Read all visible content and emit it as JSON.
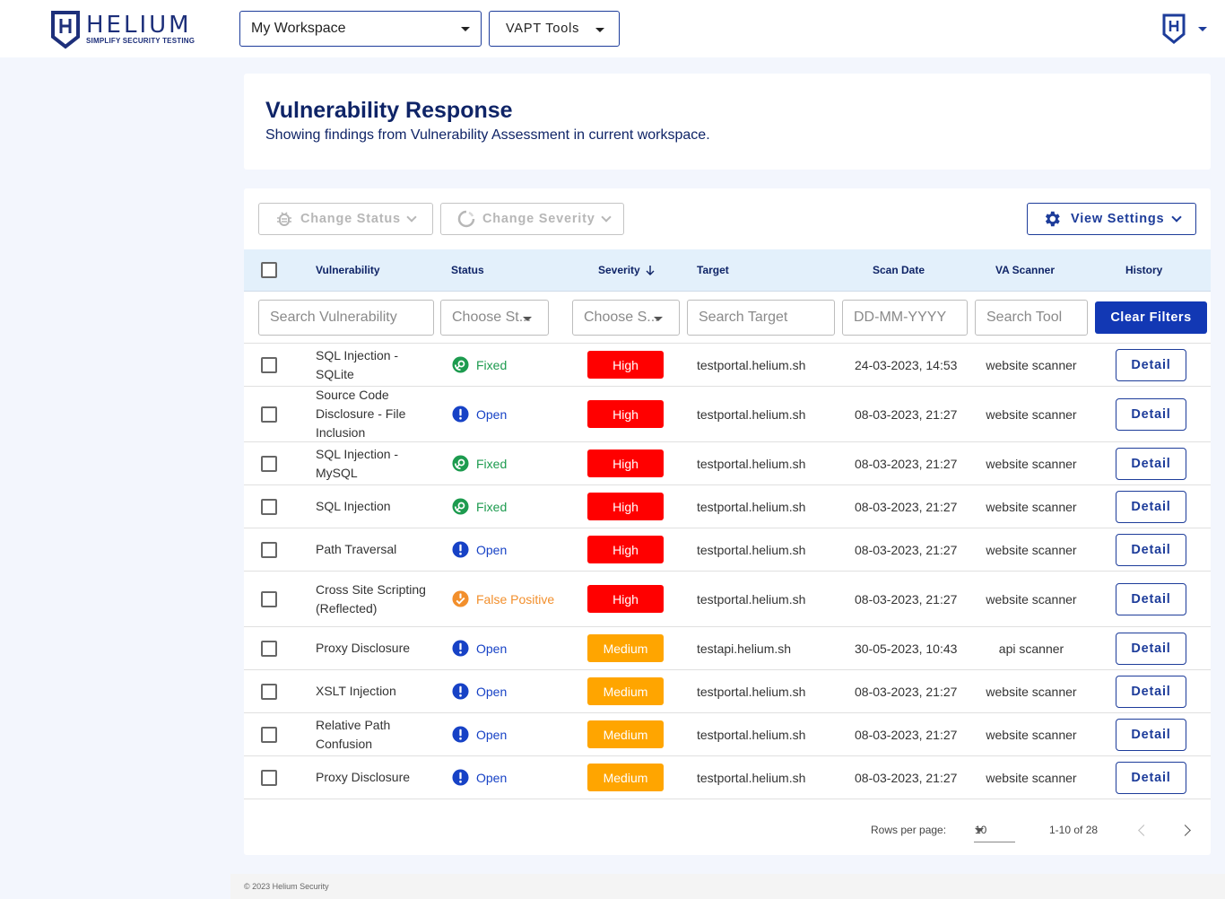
{
  "brand": {
    "name": "HELIUM",
    "tagline": "SIMPLIFY SECURITY TESTING",
    "color": "#1d2f7a"
  },
  "topbar": {
    "workspace_selected": "My Workspace",
    "vapt_tools_label": "VAPT Tools",
    "user_menu_icon": "helium-shield-icon"
  },
  "header": {
    "title": "Vulnerability Response",
    "subtitle": "Showing findings from Vulnerability Assessment in current workspace."
  },
  "toolbar": {
    "change_status_label": "Change Status",
    "change_status_icon": "bug-icon",
    "change_severity_label": "Change Severity",
    "change_severity_icon": "circle-progress-icon",
    "view_settings_label": "View Settings",
    "view_settings_icon": "gear-icon"
  },
  "table": {
    "columns": [
      "Vulnerability",
      "Status",
      "Severity",
      "Target",
      "Scan Date",
      "VA Scanner",
      "History"
    ],
    "sort_column": "Severity",
    "sort_direction": "descending",
    "filters": {
      "vulnerability_placeholder": "Search Vulnerability",
      "status_placeholder": "Choose St...",
      "severity_placeholder": "Choose S...",
      "target_placeholder": "Search Target",
      "date_placeholder": "DD-MM-YYYY",
      "tool_placeholder": "Search Tool",
      "clear_label": "Clear Filters"
    },
    "detail_label": "Detail",
    "rows": [
      {
        "name": "SQL Injection - SQLite",
        "status": "Fixed",
        "severity": "High",
        "target": "testportal.helium.sh",
        "date": "24-03-2023, 14:53",
        "scanner": "website scanner"
      },
      {
        "name": "Source Code Disclosure - File Inclusion",
        "status": "Open",
        "severity": "High",
        "target": "testportal.helium.sh",
        "date": "08-03-2023, 21:27",
        "scanner": "website scanner"
      },
      {
        "name": "SQL Injection - MySQL",
        "status": "Fixed",
        "severity": "High",
        "target": "testportal.helium.sh",
        "date": "08-03-2023, 21:27",
        "scanner": "website scanner"
      },
      {
        "name": "SQL Injection",
        "status": "Fixed",
        "severity": "High",
        "target": "testportal.helium.sh",
        "date": "08-03-2023, 21:27",
        "scanner": "website scanner"
      },
      {
        "name": "Path Traversal",
        "status": "Open",
        "severity": "High",
        "target": "testportal.helium.sh",
        "date": "08-03-2023, 21:27",
        "scanner": "website scanner"
      },
      {
        "name": "Cross Site Scripting (Reflected)",
        "status": "False Positive",
        "severity": "High",
        "target": "testportal.helium.sh",
        "date": "08-03-2023, 21:27",
        "scanner": "website scanner"
      },
      {
        "name": "Proxy Disclosure",
        "status": "Open",
        "severity": "Medium",
        "target": "testapi.helium.sh",
        "date": "30-05-2023, 10:43",
        "scanner": "api scanner"
      },
      {
        "name": "XSLT Injection",
        "status": "Open",
        "severity": "Medium",
        "target": "testportal.helium.sh",
        "date": "08-03-2023, 21:27",
        "scanner": "website scanner"
      },
      {
        "name": "Relative Path Confusion",
        "status": "Open",
        "severity": "Medium",
        "target": "testportal.helium.sh",
        "date": "08-03-2023, 21:27",
        "scanner": "website scanner"
      },
      {
        "name": "Proxy Disclosure",
        "status": "Open",
        "severity": "Medium",
        "target": "testportal.helium.sh",
        "date": "08-03-2023, 21:27",
        "scanner": "website scanner"
      }
    ]
  },
  "colors": {
    "high": "#ff0000",
    "medium": "#ffa500",
    "fixed": "#1d9b4f",
    "open": "#1742c6",
    "false_positive": "#f28f2c",
    "primary": "#1238b4"
  },
  "pagination": {
    "rows_per_page_label": "Rows per page:",
    "rows_per_page": "10",
    "range": "1-10 of 28"
  },
  "footer": {
    "copyright": "© 2023 Helium Security"
  }
}
